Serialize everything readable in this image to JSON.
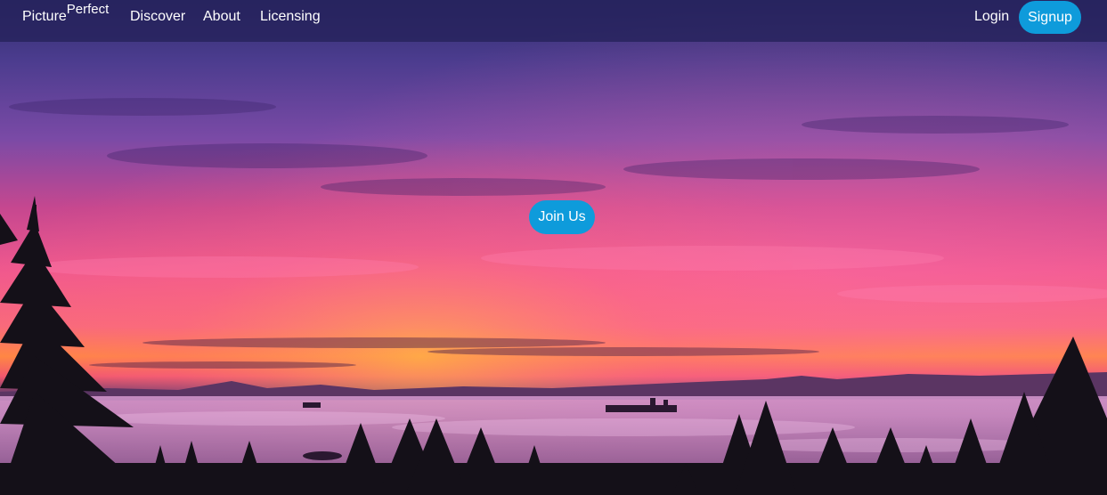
{
  "navbar": {
    "brand_main": "Picture",
    "brand_super": "Perfect",
    "links": {
      "discover": "Discover",
      "about": "About",
      "licensing": "Licensing",
      "login": "Login"
    },
    "signup_label": "Signup"
  },
  "hero": {
    "cta_label": "Join Us",
    "image": "sunset-over-clouds-with-pine-silhouettes"
  },
  "colors": {
    "accent": "#0e9bdb",
    "navbar": "#26225c",
    "text": "#ffffff"
  }
}
